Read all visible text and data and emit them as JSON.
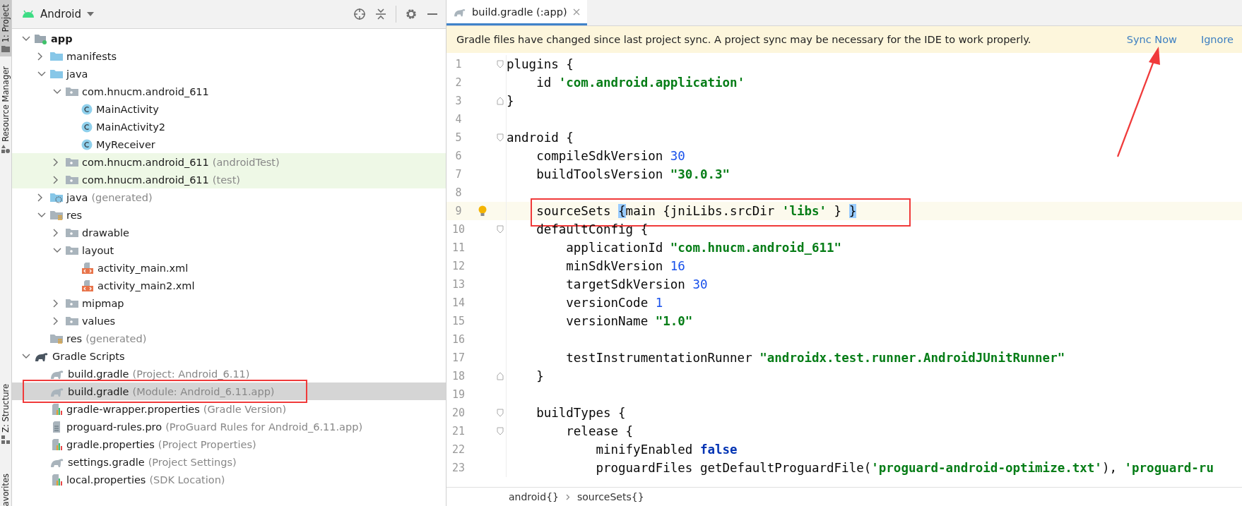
{
  "tool_strip": [
    {
      "label": "1: Project",
      "selected": true,
      "kind": "project"
    },
    {
      "label": "Resource Manager",
      "selected": false,
      "kind": "resources"
    },
    {
      "label": "Z: Structure",
      "selected": false,
      "kind": "structure"
    },
    {
      "label": "avorites",
      "selected": false,
      "kind": "plain"
    }
  ],
  "project_panel": {
    "view": "Android"
  },
  "tree": [
    {
      "label": "app",
      "kind": "module",
      "expanded": true,
      "selected": false,
      "children": [
        {
          "label": "manifests",
          "kind": "folder",
          "expanded": false,
          "selected": false
        },
        {
          "label": "java",
          "kind": "folder",
          "expanded": true,
          "selected": false,
          "children": [
            {
              "label": "com.hnucm.android_611",
              "kind": "package",
              "expanded": true,
              "selected": false,
              "children": [
                {
                  "label": "MainActivity",
                  "kind": "class",
                  "selected": false
                },
                {
                  "label": "MainActivity2",
                  "kind": "class",
                  "selected": false
                },
                {
                  "label": "MyReceiver",
                  "kind": "class",
                  "selected": false
                }
              ]
            },
            {
              "label": "com.hnucm.android_611",
              "note": "(androidTest)",
              "kind": "package",
              "expanded": false,
              "highlighted": true,
              "selected": false
            },
            {
              "label": "com.hnucm.android_611",
              "note": "(test)",
              "kind": "package",
              "expanded": false,
              "highlighted": true,
              "selected": false
            }
          ]
        },
        {
          "label": "java",
          "note": "(generated)",
          "kind": "generated",
          "expanded": false,
          "selected": false
        },
        {
          "label": "res",
          "kind": "res",
          "expanded": true,
          "selected": false,
          "children": [
            {
              "label": "drawable",
              "kind": "package",
              "expanded": false,
              "selected": false
            },
            {
              "label": "layout",
              "kind": "package",
              "expanded": true,
              "selected": false,
              "children": [
                {
                  "label": "activity_main.xml",
                  "kind": "xml",
                  "selected": false
                },
                {
                  "label": "activity_main2.xml",
                  "kind": "xml",
                  "selected": false
                }
              ]
            },
            {
              "label": "mipmap",
              "kind": "package",
              "expanded": false,
              "selected": false
            },
            {
              "label": "values",
              "kind": "package",
              "expanded": false,
              "selected": false
            }
          ]
        },
        {
          "label": "res",
          "note": "(generated)",
          "kind": "res",
          "selected": false
        }
      ]
    },
    {
      "label": "Gradle Scripts",
      "kind": "scripts",
      "expanded": true,
      "selected": false,
      "children": [
        {
          "label": "build.gradle",
          "note": "(Project: Android_6.11)",
          "kind": "gradle",
          "selected": false
        },
        {
          "label": "build.gradle",
          "note": "(Module: Android_6.11.app)",
          "kind": "gradle",
          "selected": true,
          "annotated": true
        },
        {
          "label": "gradle-wrapper.properties",
          "note": "(Gradle Version)",
          "kind": "properties",
          "selected": false
        },
        {
          "label": "proguard-rules.pro",
          "note": "(ProGuard Rules for Android_6.11.app)",
          "kind": "text",
          "selected": false
        },
        {
          "label": "gradle.properties",
          "note": "(Project Properties)",
          "kind": "properties",
          "selected": false
        },
        {
          "label": "settings.gradle",
          "note": "(Project Settings)",
          "kind": "gradle",
          "selected": false
        },
        {
          "label": "local.properties",
          "note": "(SDK Location)",
          "kind": "properties",
          "selected": false
        }
      ]
    }
  ],
  "editor_tabs": [
    {
      "label": "build.gradle (:app)",
      "selected": true
    }
  ],
  "banner": {
    "message": "Gradle files have changed since last project sync. A project sync may be necessary for the IDE to work properly.",
    "actions": [
      "Sync Now",
      "Ignore"
    ]
  },
  "code": [
    {
      "n": "1",
      "kind": "open",
      "tokens": [
        {
          "t": "plugins {",
          "kind": "plain"
        }
      ]
    },
    {
      "n": "2",
      "kind": "plain",
      "tokens": [
        {
          "t": "    id ",
          "kind": "plain"
        },
        {
          "t": "'com.android.application'",
          "kind": "string"
        }
      ]
    },
    {
      "n": "3",
      "kind": "close",
      "tokens": [
        {
          "t": "}",
          "kind": "plain"
        }
      ]
    },
    {
      "n": "4",
      "kind": "plain"
    },
    {
      "n": "5",
      "kind": "open",
      "tokens": [
        {
          "t": "android {",
          "kind": "plain"
        }
      ]
    },
    {
      "n": "6",
      "kind": "plain",
      "tokens": [
        {
          "t": "    compileSdkVersion ",
          "kind": "plain"
        },
        {
          "t": "30",
          "kind": "number"
        }
      ]
    },
    {
      "n": "7",
      "kind": "plain",
      "tokens": [
        {
          "t": "    buildToolsVersion ",
          "kind": "plain"
        },
        {
          "t": "\"30.0.3\"",
          "kind": "string"
        }
      ]
    },
    {
      "n": "8",
      "kind": "plain"
    },
    {
      "n": "9",
      "kind": "plain",
      "current": true,
      "bulb": true,
      "annotated": true,
      "tokens": [
        {
          "t": "    sourceSets ",
          "kind": "plain"
        },
        {
          "t": "{",
          "kind": "match"
        },
        {
          "t": "main {jniLibs.srcDir ",
          "kind": "plain"
        },
        {
          "t": "'libs'",
          "kind": "string"
        },
        {
          "t": " } ",
          "kind": "plain"
        },
        {
          "t": "}",
          "kind": "match"
        }
      ]
    },
    {
      "n": "10",
      "kind": "open",
      "tokens": [
        {
          "t": "    defaultConfig {",
          "kind": "plain"
        }
      ]
    },
    {
      "n": "11",
      "kind": "plain",
      "tokens": [
        {
          "t": "        applicationId ",
          "kind": "plain"
        },
        {
          "t": "\"com.hnucm.android_611\"",
          "kind": "string"
        }
      ]
    },
    {
      "n": "12",
      "kind": "plain",
      "tokens": [
        {
          "t": "        minSdkVersion ",
          "kind": "plain"
        },
        {
          "t": "16",
          "kind": "number"
        }
      ]
    },
    {
      "n": "13",
      "kind": "plain",
      "tokens": [
        {
          "t": "        targetSdkVersion ",
          "kind": "plain"
        },
        {
          "t": "30",
          "kind": "number"
        }
      ]
    },
    {
      "n": "14",
      "kind": "plain",
      "tokens": [
        {
          "t": "        versionCode ",
          "kind": "plain"
        },
        {
          "t": "1",
          "kind": "number"
        }
      ]
    },
    {
      "n": "15",
      "kind": "plain",
      "tokens": [
        {
          "t": "        versionName ",
          "kind": "plain"
        },
        {
          "t": "\"1.0\"",
          "kind": "string"
        }
      ]
    },
    {
      "n": "16",
      "kind": "plain"
    },
    {
      "n": "17",
      "kind": "plain",
      "tokens": [
        {
          "t": "        testInstrumentationRunner ",
          "kind": "plain"
        },
        {
          "t": "\"androidx.test.runner.AndroidJUnitRunner\"",
          "kind": "string"
        }
      ]
    },
    {
      "n": "18",
      "kind": "close",
      "tokens": [
        {
          "t": "    }",
          "kind": "plain"
        }
      ]
    },
    {
      "n": "19",
      "kind": "plain"
    },
    {
      "n": "20",
      "kind": "open",
      "tokens": [
        {
          "t": "    buildTypes {",
          "kind": "plain"
        }
      ]
    },
    {
      "n": "21",
      "kind": "open",
      "tokens": [
        {
          "t": "        release {",
          "kind": "plain"
        }
      ]
    },
    {
      "n": "22",
      "kind": "plain",
      "tokens": [
        {
          "t": "            minifyEnabled ",
          "kind": "plain"
        },
        {
          "t": "false",
          "kind": "keyword"
        }
      ]
    },
    {
      "n": "23",
      "kind": "plain",
      "tokens": [
        {
          "t": "            proguardFiles getDefaultProguardFile(",
          "kind": "plain"
        },
        {
          "t": "'proguard-android-optimize.txt'",
          "kind": "string"
        },
        {
          "t": "), ",
          "kind": "plain"
        },
        {
          "t": "'proguard-ru",
          "kind": "string"
        }
      ]
    }
  ],
  "breadcrumbs": [
    "android{}",
    "sourceSets{}"
  ]
}
